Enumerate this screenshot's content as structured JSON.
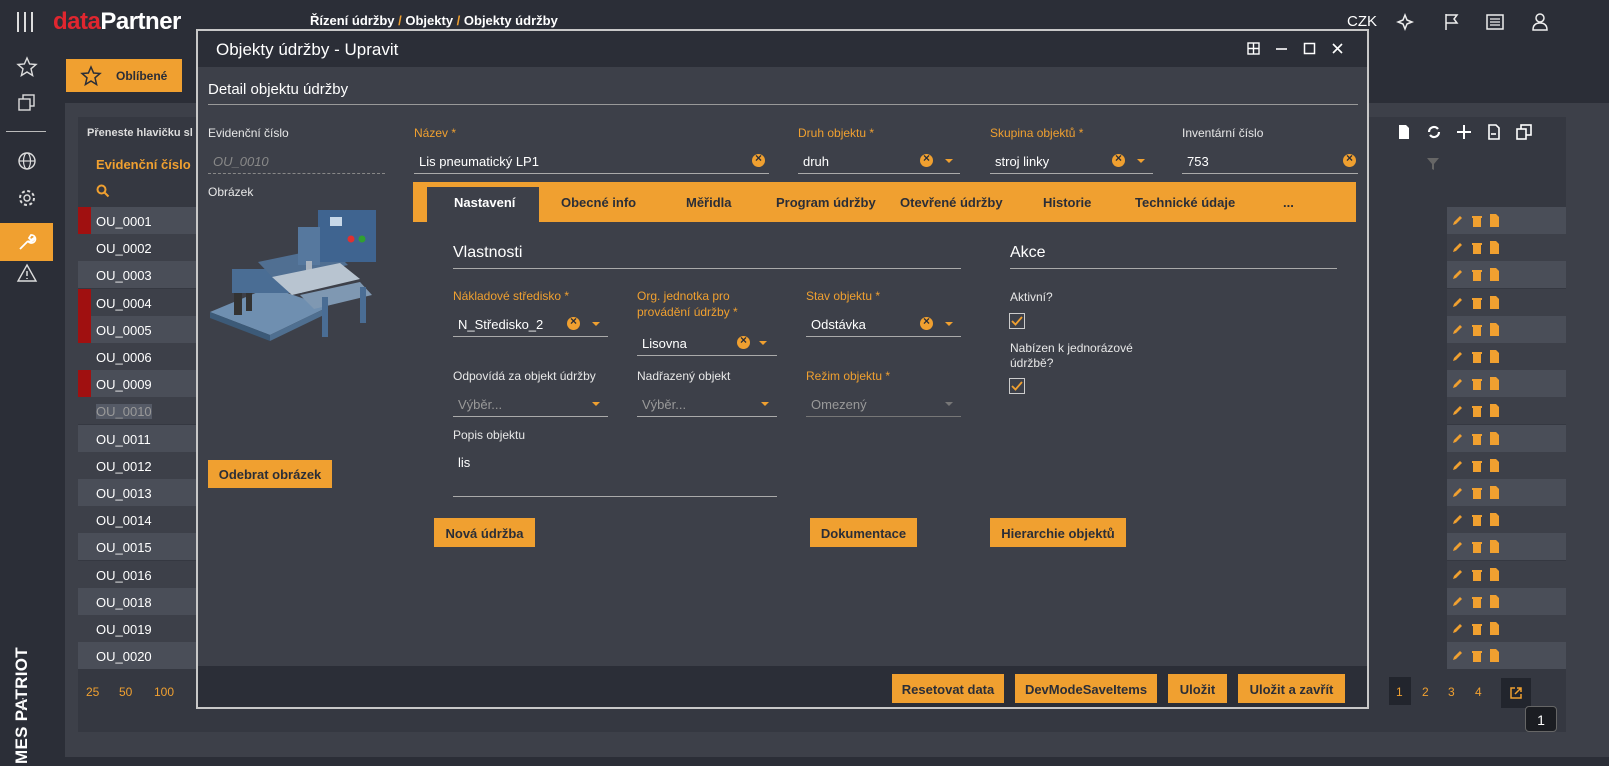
{
  "topbar": {
    "brand_data": "data",
    "brand_partner": "Partner",
    "breadcrumb": [
      "Řízení údržby",
      "Objekty",
      "Objekty údržby"
    ],
    "currency": "CZK"
  },
  "rail": {
    "vertical_label": "MES PATRIOT",
    "info": "i"
  },
  "background": {
    "favorites_label": "Oblíbené",
    "header_text": "Přeneste hlavičku sl",
    "column_header": "Evidenční číslo",
    "rows": [
      "OU_0001",
      "OU_0002",
      "OU_0003",
      "OU_0004",
      "OU_0005",
      "OU_0006",
      "OU_0009",
      "OU_0010",
      "OU_0011",
      "OU_0012",
      "OU_0013",
      "OU_0014",
      "OU_0015",
      "OU_0016",
      "OU_0018",
      "OU_0019",
      "OU_0020"
    ],
    "page_sizes": [
      "25",
      "50",
      "100"
    ],
    "pages": [
      "1",
      "2",
      "3",
      "4"
    ],
    "badge": "1"
  },
  "modal": {
    "title": "Objekty údržby - Upravit",
    "section": "Detail objektu údržby",
    "evid_label": "Evidenční číslo",
    "evid_value": "OU_0010",
    "image_label": "Obrázek",
    "remove_image": "Odebrat obrázek",
    "name_label": "Název *",
    "name_value": "Lis pneumatický LP1",
    "kind_label": "Druh objektu *",
    "kind_value": "druh",
    "group_label": "Skupina objektů *",
    "group_value": "stroj linky",
    "inv_label": "Inventární číslo",
    "inv_value": "753",
    "tabs": [
      "Nastavení",
      "Obecné info",
      "Měřidla",
      "Program údržby",
      "Otevřené údržby",
      "Historie",
      "Technické údaje",
      "..."
    ],
    "props_title": "Vlastnosti",
    "actions_title": "Akce",
    "cost_label": "Nákladové středisko *",
    "cost_value": "N_Středisko_2",
    "org_label_1": "Org. jednotka pro",
    "org_label_2": "provádění údržby *",
    "org_value": "Lisovna",
    "state_label": "Stav objektu *",
    "state_value": "Odstávka",
    "resp_label": "Odpovídá za objekt údržby",
    "resp_placeholder": "Výběr...",
    "parent_label": "Nadřazený objekt",
    "parent_placeholder": "Výběr...",
    "mode_label": "Režim objektu *",
    "mode_value": "Omezený",
    "desc_label": "Popis objektu",
    "desc_value": "lis",
    "active_label": "Aktivní?",
    "offered_label_1": "Nabízen k jednorázové",
    "offered_label_2": "údržbě?",
    "btn_new": "Nová údržba",
    "btn_docs": "Dokumentace",
    "btn_hier": "Hierarchie objektů",
    "btn_reset": "Resetovat data",
    "btn_dev": "DevModeSaveItems",
    "btn_save": "Uložit",
    "btn_save_close": "Uložit a zavřít"
  },
  "colors": {
    "accent": "#f0a030",
    "bg": "#2b2e37",
    "panel": "#3d4049",
    "flag": "#a01010"
  }
}
